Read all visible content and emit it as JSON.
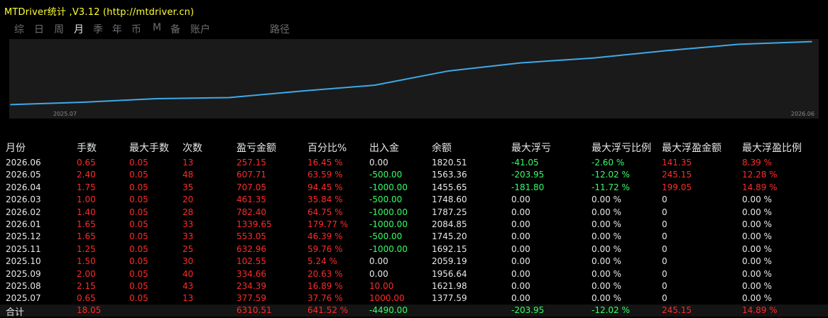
{
  "window": {
    "title": "MTDriver统计 ,V3.12 (http://mtdriver.cn)"
  },
  "tabs": [
    {
      "label": "综",
      "active": false
    },
    {
      "label": "日",
      "active": false
    },
    {
      "label": "周",
      "active": false
    },
    {
      "label": "月",
      "active": true
    },
    {
      "label": "季",
      "active": false
    },
    {
      "label": "年",
      "active": false
    },
    {
      "label": "币",
      "active": false
    },
    {
      "label": "M",
      "active": false
    },
    {
      "label": "备",
      "active": false
    },
    {
      "label": "账户",
      "active": false
    },
    {
      "label": "路径",
      "active": false
    }
  ],
  "chart_data": {
    "type": "line",
    "x": [
      "2025.07",
      "2025.08",
      "2025.09",
      "2025.10",
      "2025.11",
      "2025.12",
      "2026.01",
      "2026.02",
      "2026.03",
      "2026.04",
      "2026.05",
      "2026.06"
    ],
    "x_tick_labels": [
      "2025.07",
      "2026.06"
    ],
    "series": [
      {
        "values": [
          377.59,
          611.98,
          946.64,
          1049.19,
          1682.15,
          2235.2,
          3574.85,
          4357.25,
          4818.6,
          5525.65,
          6133.36,
          6390.51
        ]
      }
    ],
    "ylim": [
      0,
      6500
    ],
    "grid": false,
    "line_color": "#3fa9e8"
  },
  "table": {
    "headers": [
      "月份",
      "手数",
      "最大手数",
      "次数",
      "盈亏金额",
      "百分比%",
      "出入金",
      "余额",
      "最大浮亏",
      "最大浮亏比例",
      "最大浮盈金额",
      "最大浮盈比例"
    ],
    "rows": [
      {
        "month": "2026.06",
        "lots": "0.65",
        "max_lots": "0.05",
        "count": "13",
        "pnl": "257.15",
        "pct": "16.45 %",
        "flow": "0.00",
        "balance": "1820.51",
        "max_dd": "-41.05",
        "max_dd_pct": "-2.60 %",
        "max_fp": "141.35",
        "max_fp_pct": "8.39 %"
      },
      {
        "month": "2026.05",
        "lots": "2.40",
        "max_lots": "0.05",
        "count": "48",
        "pnl": "607.71",
        "pct": "63.59 %",
        "flow": "-500.00",
        "balance": "1563.36",
        "max_dd": "-203.95",
        "max_dd_pct": "-12.02 %",
        "max_fp": "245.15",
        "max_fp_pct": "12.28 %"
      },
      {
        "month": "2026.04",
        "lots": "1.75",
        "max_lots": "0.05",
        "count": "35",
        "pnl": "707.05",
        "pct": "94.45 %",
        "flow": "-1000.00",
        "balance": "1455.65",
        "max_dd": "-181.80",
        "max_dd_pct": "-11.72 %",
        "max_fp": "199.05",
        "max_fp_pct": "14.89 %"
      },
      {
        "month": "2026.03",
        "lots": "1.00",
        "max_lots": "0.05",
        "count": "20",
        "pnl": "461.35",
        "pct": "35.84 %",
        "flow": "-500.00",
        "balance": "1748.60",
        "max_dd": "0.00",
        "max_dd_pct": "0.00 %",
        "max_fp": "0",
        "max_fp_pct": "0.00 %"
      },
      {
        "month": "2026.02",
        "lots": "1.40",
        "max_lots": "0.05",
        "count": "28",
        "pnl": "782.40",
        "pct": "64.75 %",
        "flow": "-1000.00",
        "balance": "1787.25",
        "max_dd": "0.00",
        "max_dd_pct": "0.00 %",
        "max_fp": "0",
        "max_fp_pct": "0.00 %"
      },
      {
        "month": "2026.01",
        "lots": "1.65",
        "max_lots": "0.05",
        "count": "33",
        "pnl": "1339.65",
        "pct": "179.77 %",
        "flow": "-1000.00",
        "balance": "2084.85",
        "max_dd": "0.00",
        "max_dd_pct": "0.00 %",
        "max_fp": "0",
        "max_fp_pct": "0.00 %"
      },
      {
        "month": "2025.12",
        "lots": "1.65",
        "max_lots": "0.05",
        "count": "33",
        "pnl": "553.05",
        "pct": "46.39 %",
        "flow": "-500.00",
        "balance": "1745.20",
        "max_dd": "0.00",
        "max_dd_pct": "0.00 %",
        "max_fp": "0",
        "max_fp_pct": "0.00 %"
      },
      {
        "month": "2025.11",
        "lots": "1.25",
        "max_lots": "0.05",
        "count": "25",
        "pnl": "632.96",
        "pct": "59.76 %",
        "flow": "-1000.00",
        "balance": "1692.15",
        "max_dd": "0.00",
        "max_dd_pct": "0.00 %",
        "max_fp": "0",
        "max_fp_pct": "0.00 %"
      },
      {
        "month": "2025.10",
        "lots": "1.50",
        "max_lots": "0.05",
        "count": "30",
        "pnl": "102.55",
        "pct": "5.24 %",
        "flow": "0.00",
        "balance": "2059.19",
        "max_dd": "0.00",
        "max_dd_pct": "0.00 %",
        "max_fp": "0",
        "max_fp_pct": "0.00 %"
      },
      {
        "month": "2025.09",
        "lots": "2.00",
        "max_lots": "0.05",
        "count": "40",
        "pnl": "334.66",
        "pct": "20.63 %",
        "flow": "0.00",
        "balance": "1956.64",
        "max_dd": "0.00",
        "max_dd_pct": "0.00 %",
        "max_fp": "0",
        "max_fp_pct": "0.00 %"
      },
      {
        "month": "2025.08",
        "lots": "2.15",
        "max_lots": "0.05",
        "count": "43",
        "pnl": "234.39",
        "pct": "16.89 %",
        "flow": "10.00",
        "balance": "1621.98",
        "max_dd": "0.00",
        "max_dd_pct": "0.00 %",
        "max_fp": "0",
        "max_fp_pct": "0.00 %"
      },
      {
        "month": "2025.07",
        "lots": "0.65",
        "max_lots": "0.05",
        "count": "13",
        "pnl": "377.59",
        "pct": "37.76 %",
        "flow": "1000.00",
        "balance": "1377.59",
        "max_dd": "0.00",
        "max_dd_pct": "0.00 %",
        "max_fp": "0",
        "max_fp_pct": "0.00 %"
      }
    ],
    "total": {
      "label": "合计",
      "lots": "18.05",
      "pnl": "6310.51",
      "pct": "641.52 %",
      "flow": "-4490.00",
      "max_dd": "-203.95",
      "max_dd_pct": "-12.02 %",
      "max_fp": "245.15",
      "max_fp_pct": "14.89 %"
    }
  },
  "colors": {
    "positive": "#ff2a2a",
    "negative": "#33ff66",
    "neutral": "#e8e8e8",
    "title": "#ffff33"
  }
}
